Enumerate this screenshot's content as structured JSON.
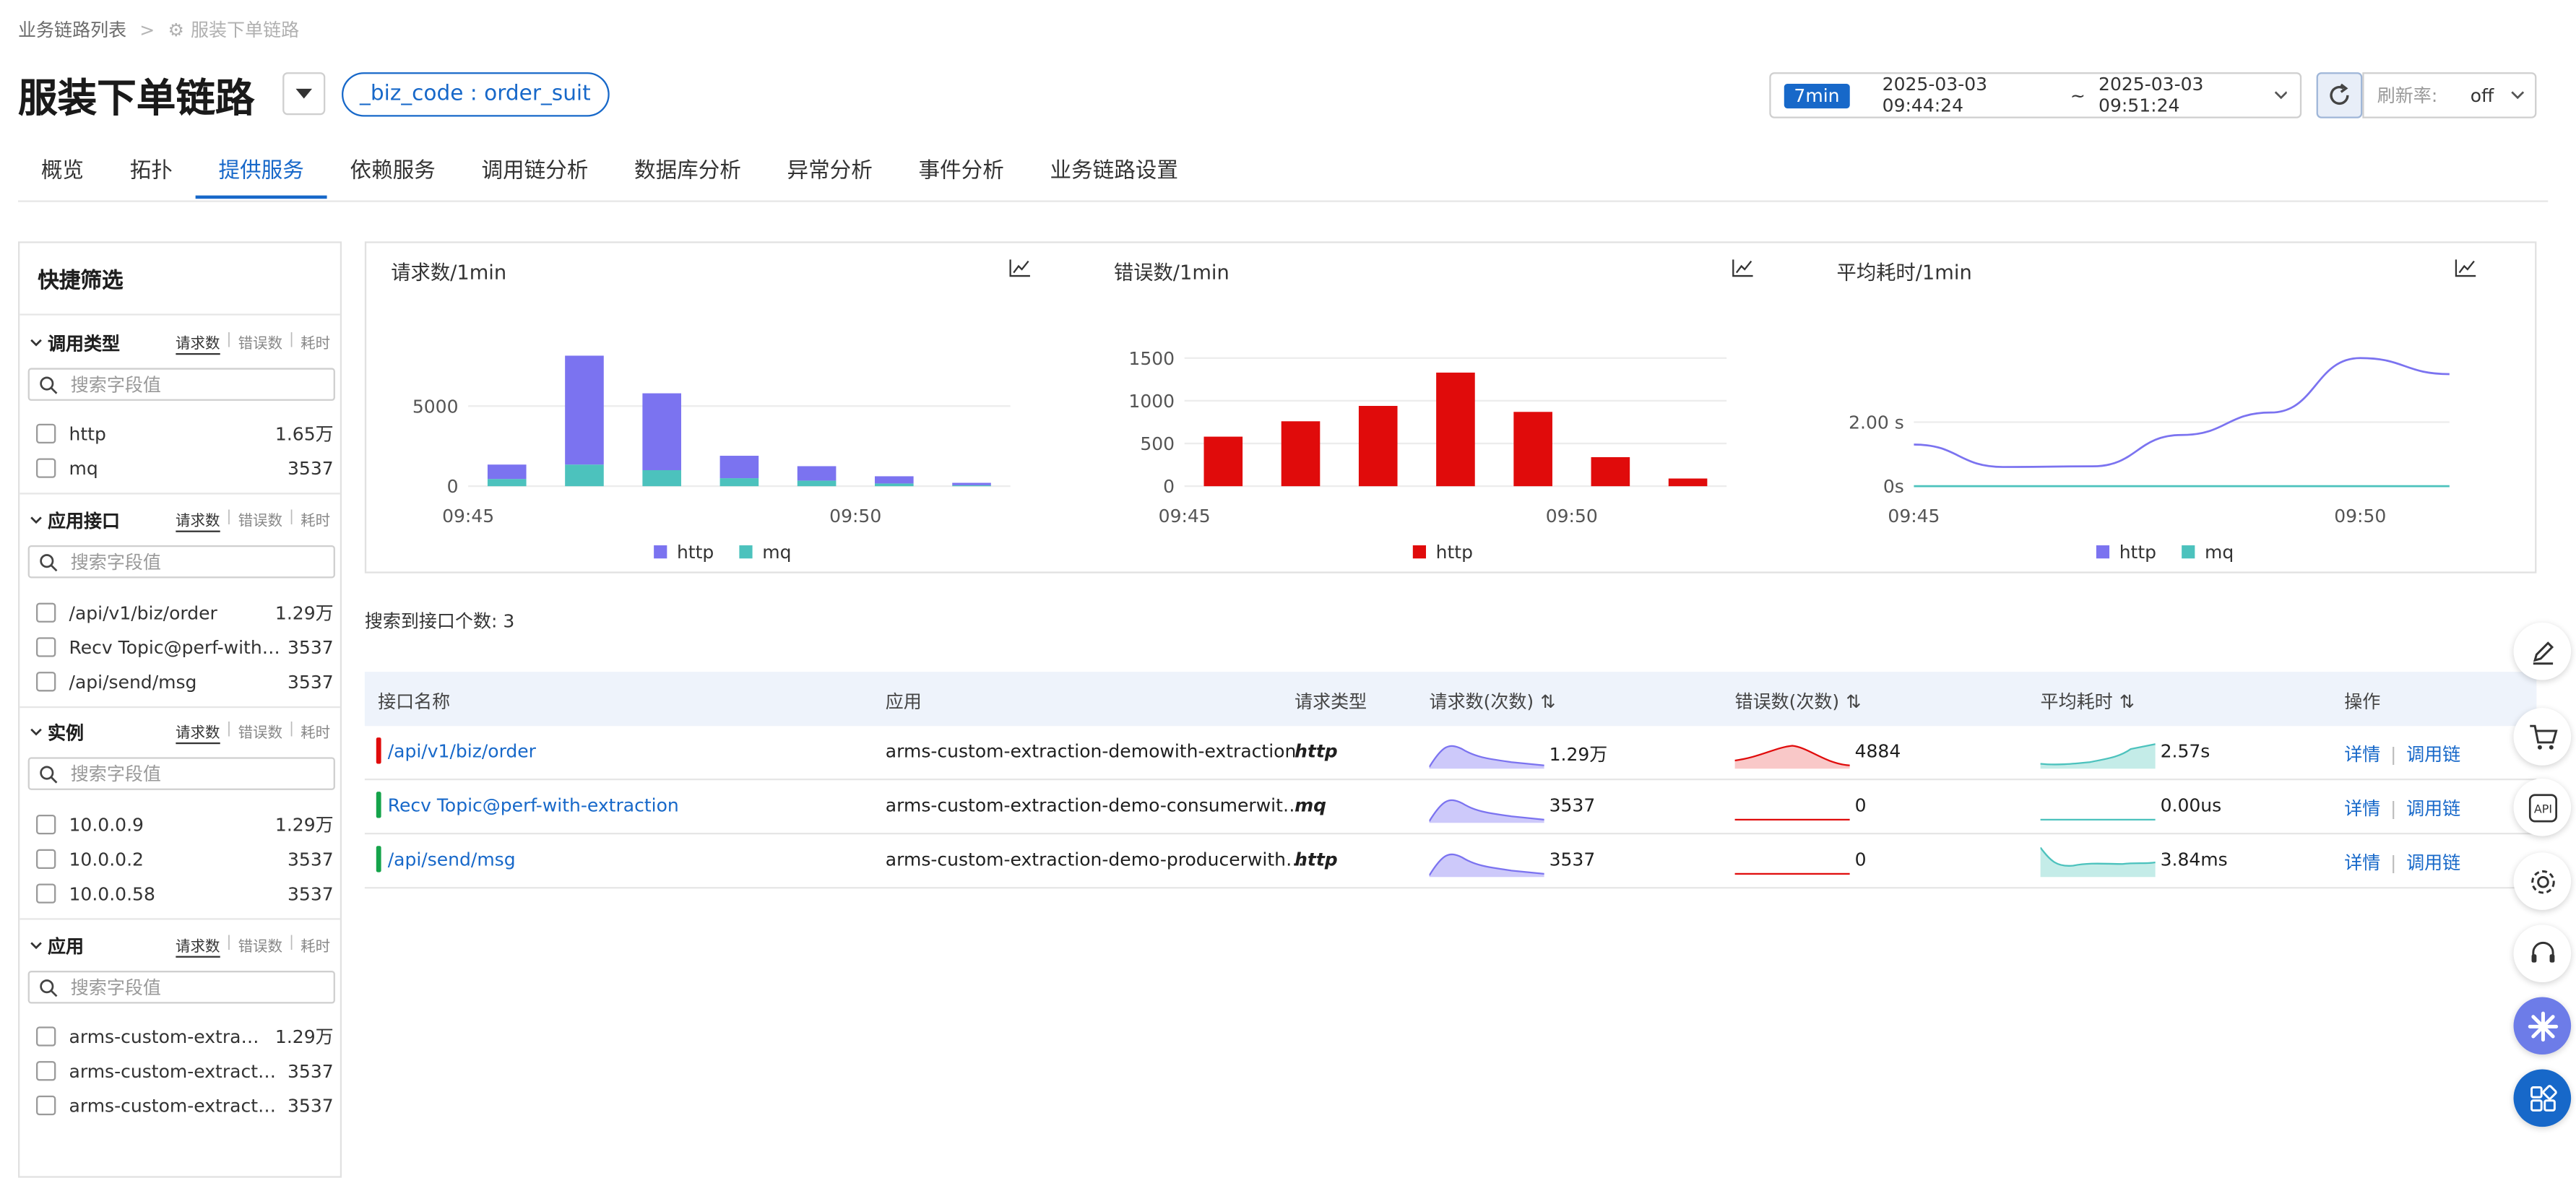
{
  "breadcrumb": {
    "root": "业务链路列表",
    "current": "服装下单链路"
  },
  "header": {
    "title": "服装下单链路",
    "biz_tag": "_biz_code : order_suit",
    "time_range": {
      "badge": "7min",
      "start": "2025-03-03 09:44:24",
      "sep": "~",
      "end": "2025-03-03 09:51:24"
    },
    "refresh_label": "刷新率:",
    "refresh_value": "off"
  },
  "tabs": [
    "概览",
    "拓扑",
    "提供服务",
    "依赖服务",
    "调用链分析",
    "数据库分析",
    "异常分析",
    "事件分析",
    "业务链路设置"
  ],
  "active_tab": "提供服务",
  "filters": {
    "title": "快捷筛选",
    "metric_tabs": [
      "请求数",
      "错误数",
      "耗时"
    ],
    "search_placeholder": "搜索字段值",
    "groups": [
      {
        "label": "调用类型",
        "items": [
          {
            "name": "http",
            "count": "1.65万"
          },
          {
            "name": "mq",
            "count": "3537"
          }
        ]
      },
      {
        "label": "应用接口",
        "items": [
          {
            "name": "/api/v1/biz/order",
            "count": "1.29万"
          },
          {
            "name": "Recv Topic@perf-with-extraction",
            "count": "3537"
          },
          {
            "name": "/api/send/msg",
            "count": "3537"
          }
        ]
      },
      {
        "label": "实例",
        "items": [
          {
            "name": "10.0.0.9",
            "count": "1.29万"
          },
          {
            "name": "10.0.0.2",
            "count": "3537"
          },
          {
            "name": "10.0.0.58",
            "count": "3537"
          }
        ]
      },
      {
        "label": "应用",
        "items": [
          {
            "name": "arms-custom-extraction-demowith-extraction",
            "count": "1.29万"
          },
          {
            "name": "arms-custom-extraction-demo-consumerwith-extraction",
            "count": "3537"
          },
          {
            "name": "arms-custom-extraction-demo-producerwith-extraction",
            "count": "3537"
          }
        ]
      }
    ]
  },
  "chart_data": [
    {
      "type": "bar",
      "title": "请求数/1min",
      "stacked": true,
      "categories": [
        "09:45",
        "09:46",
        "09:47",
        "09:48",
        "09:49",
        "09:50",
        "09:51"
      ],
      "x_tick_labels": [
        "09:45",
        "09:50"
      ],
      "y_tick_labels": [
        "0",
        "5000"
      ],
      "ylim": [
        0,
        8000
      ],
      "series": [
        {
          "name": "http",
          "color": "#7b73f0",
          "values": [
            900,
            6800,
            4800,
            1400,
            900,
            450,
            150
          ]
        },
        {
          "name": "mq",
          "color": "#4cc2bd",
          "values": [
            450,
            1350,
            1000,
            500,
            350,
            170,
            60
          ]
        }
      ],
      "legend": "bottom"
    },
    {
      "type": "bar",
      "title": "错误数/1min",
      "categories": [
        "09:45",
        "09:46",
        "09:47",
        "09:48",
        "09:49",
        "09:50",
        "09:51"
      ],
      "x_tick_labels": [
        "09:45",
        "09:50"
      ],
      "y_tick_labels": [
        "0",
        "500",
        "1000",
        "1500"
      ],
      "ylim": [
        0,
        1500
      ],
      "series": [
        {
          "name": "http",
          "color": "#e00b0b",
          "values": [
            580,
            760,
            940,
            1330,
            870,
            340,
            90
          ]
        }
      ],
      "legend": "bottom"
    },
    {
      "type": "line",
      "title": "平均耗时/1min",
      "x": [
        "09:45",
        "09:46",
        "09:47",
        "09:48",
        "09:49",
        "09:50",
        "09:51"
      ],
      "x_tick_labels": [
        "09:45",
        "09:50"
      ],
      "y_tick_labels": [
        "0s",
        "2.00 s"
      ],
      "ylim": [
        0,
        4
      ],
      "series": [
        {
          "name": "http",
          "color": "#7b73f0",
          "values": [
            1.3,
            0.6,
            0.62,
            1.6,
            2.3,
            4.0,
            3.5
          ]
        },
        {
          "name": "mq",
          "color": "#4cc2bd",
          "values": [
            0,
            0,
            0,
            0,
            0,
            0,
            0
          ]
        }
      ],
      "legend": "bottom"
    }
  ],
  "table": {
    "count_label": "搜索到接口个数: 3",
    "headers": [
      "接口名称",
      "应用",
      "请求类型",
      "请求数(次数)",
      "错误数(次数)",
      "平均耗时",
      "操作"
    ],
    "rows": [
      {
        "name": "/api/v1/biz/order",
        "app": "arms-custom-extraction-demowith-extraction",
        "type": "http",
        "req": "1.29万",
        "err": "4884",
        "lat": "2.57s",
        "color": "#e00b0b"
      },
      {
        "name": "Recv Topic@perf-with-extraction",
        "app": "arms-custom-extraction-demo-consumerwit…",
        "type": "mq",
        "req": "3537",
        "err": "0",
        "lat": "0.00us",
        "color": "#15a34a"
      },
      {
        "name": "/api/send/msg",
        "app": "arms-custom-extraction-demo-producerwith…",
        "type": "http",
        "req": "3537",
        "err": "0",
        "lat": "3.84ms",
        "color": "#15a34a"
      }
    ],
    "actions": [
      "详情",
      "调用链"
    ]
  },
  "colors": {
    "accent": "#1768c9",
    "http": "#7b73f0",
    "mq": "#4cc2bd",
    "error": "#e00b0b"
  },
  "toolbar_icons": [
    "edit-icon",
    "cart-icon",
    "api-icon",
    "settings-icon",
    "support-icon",
    "assistant-icon",
    "apps-icon"
  ]
}
